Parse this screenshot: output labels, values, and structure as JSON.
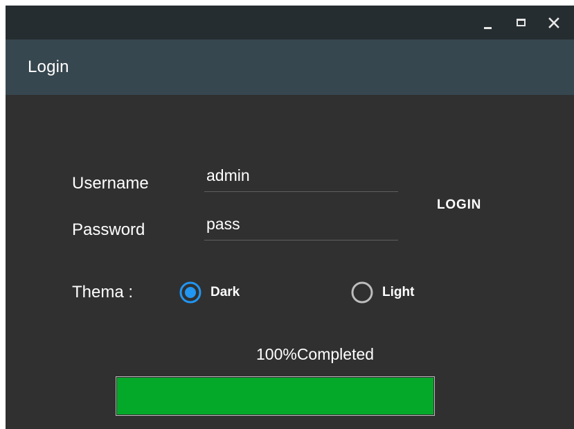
{
  "window": {
    "controls": {
      "minimize_icon": "minimize-icon",
      "maximize_icon": "maximize-icon",
      "close_icon": "close-icon"
    }
  },
  "header": {
    "title": "Login"
  },
  "form": {
    "username_label": "Username",
    "username_value": "admin",
    "password_label": "Password",
    "password_value": "pass",
    "login_label": "LOGIN"
  },
  "theme": {
    "label": "Thema :",
    "options": [
      {
        "label": "Dark",
        "selected": true
      },
      {
        "label": "Light",
        "selected": false
      }
    ]
  },
  "progress": {
    "text": "100%Completed",
    "value": 1.0
  },
  "colors": {
    "titlebar": "#262d30",
    "header": "#37474f",
    "background": "#303030",
    "accent": "#2196f3",
    "progress_fill": "#05a92a"
  }
}
